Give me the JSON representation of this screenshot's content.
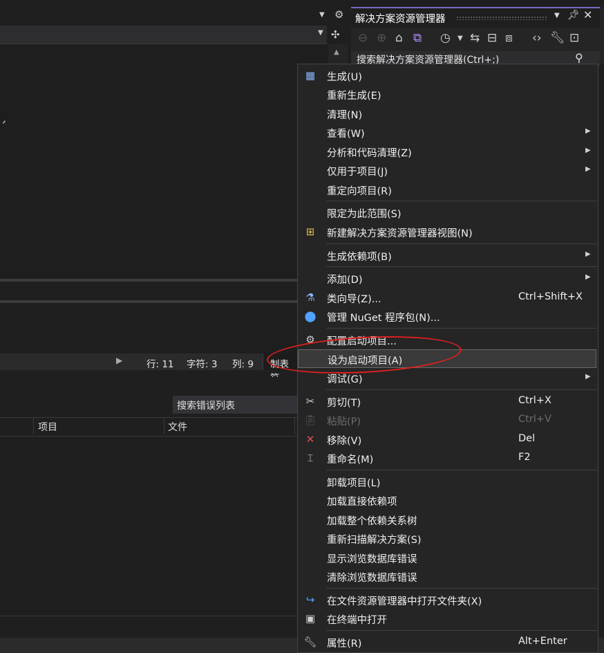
{
  "solution_explorer": {
    "title": "解决方案资源管理器",
    "search_placeholder": "搜索解决方案资源管理器(Ctrl+;)"
  },
  "status_bar": {
    "line": "行: 11",
    "char": "字符: 3",
    "col": "列: 9",
    "tab": "制表符"
  },
  "error_list": {
    "search_placeholder": "搜索错误列表",
    "columns": [
      "项目",
      "文件"
    ]
  },
  "context_menu": {
    "items": [
      {
        "label": "生成(U)",
        "icon": "build-icon"
      },
      {
        "label": "重新生成(E)"
      },
      {
        "label": "清理(N)"
      },
      {
        "label": "查看(W)",
        "submenu": true
      },
      {
        "label": "分析和代码清理(Z)",
        "submenu": true
      },
      {
        "label": "仅用于项目(J)",
        "submenu": true
      },
      {
        "label": "重定向项目(R)"
      },
      {
        "label": "限定为此范围(S)"
      },
      {
        "label": "新建解决方案资源管理器视图(N)",
        "icon": "new-view-icon"
      },
      {
        "label": "生成依赖项(B)",
        "submenu": true
      },
      {
        "label": "添加(D)",
        "submenu": true
      },
      {
        "label": "类向导(Z)...",
        "shortcut": "Ctrl+Shift+X",
        "icon": "class-wizard-icon"
      },
      {
        "label": "管理 NuGet 程序包(N)...",
        "icon": "nuget-icon"
      },
      {
        "label": "配置启动项目...",
        "icon": "gear-icon"
      },
      {
        "label": "设为启动项目(A)",
        "highlighted": true
      },
      {
        "label": "调试(G)",
        "submenu": true
      },
      {
        "label": "剪切(T)",
        "shortcut": "Ctrl+X",
        "icon": "scissors-icon"
      },
      {
        "label": "粘贴(P)",
        "shortcut": "Ctrl+V",
        "icon": "clipboard-icon",
        "disabled": true
      },
      {
        "label": "移除(V)",
        "shortcut": "Del",
        "icon": "remove-icon"
      },
      {
        "label": "重命名(M)",
        "shortcut": "F2",
        "icon": "rename-icon"
      },
      {
        "label": "卸载项目(L)"
      },
      {
        "label": "加载直接依赖项"
      },
      {
        "label": "加载整个依赖关系树"
      },
      {
        "label": "重新扫描解决方案(S)"
      },
      {
        "label": "显示浏览数据库错误"
      },
      {
        "label": "清除浏览数据库错误"
      },
      {
        "label": "在文件资源管理器中打开文件夹(X)",
        "icon": "open-folder-icon"
      },
      {
        "label": "在终端中打开",
        "icon": "terminal-icon"
      },
      {
        "label": "属性(R)",
        "shortcut": "Alt+Enter",
        "icon": "wrench-icon"
      }
    ]
  },
  "colors": {
    "accent": "#7b68c8",
    "annotation": "#e01f1f",
    "menu_bg": "#252526",
    "highlight_bg": "#3a3a3a"
  }
}
